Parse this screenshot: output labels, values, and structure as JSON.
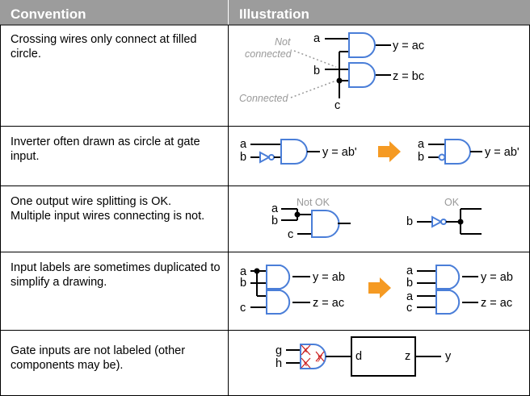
{
  "header": {
    "convention": "Convention",
    "illustration": "Illustration"
  },
  "rows": [
    {
      "text": "Crossing wires only connect at filled circle.",
      "labels": {
        "a": "a",
        "b": "b",
        "c": "c",
        "y": "y = ac",
        "z": "z = bc",
        "not_connected_1": "Not",
        "not_connected_2": "connected",
        "connected": "Connected"
      }
    },
    {
      "text": "Inverter often drawn as circle at gate input.",
      "labels": {
        "a": "a",
        "b": "b",
        "y1": "y = ab'",
        "y2": "y = ab'"
      }
    },
    {
      "text_1": "One output wire splitting is OK.",
      "text_2": "Multiple input wires connecting is not.",
      "labels": {
        "not_ok": "Not OK",
        "ok": "OK",
        "a": "a",
        "b": "b",
        "c": "c",
        "b2": "b"
      }
    },
    {
      "text": "Input labels are sometimes duplicated to simplify a drawing.",
      "labels": {
        "a": "a",
        "b": "b",
        "c": "c",
        "y": "y = ab",
        "z": "z = ac",
        "a2": "a",
        "b2": "b",
        "a3": "a",
        "c2": "c",
        "y2": "y = ab",
        "z2": "z = ac"
      }
    },
    {
      "text": "Gate inputs are not labeled (other components may be).",
      "labels": {
        "g": "g",
        "h": "h",
        "x1": "x",
        "x2": "y",
        "d": "d",
        "z": "z",
        "y": "y"
      }
    }
  ],
  "colors": {
    "header_bg": "#9c9c9c",
    "gate_stroke": "#4a7ed8",
    "arrow": "#f59a23",
    "annotation": "#999999",
    "cross_mark": "#cc2222"
  }
}
